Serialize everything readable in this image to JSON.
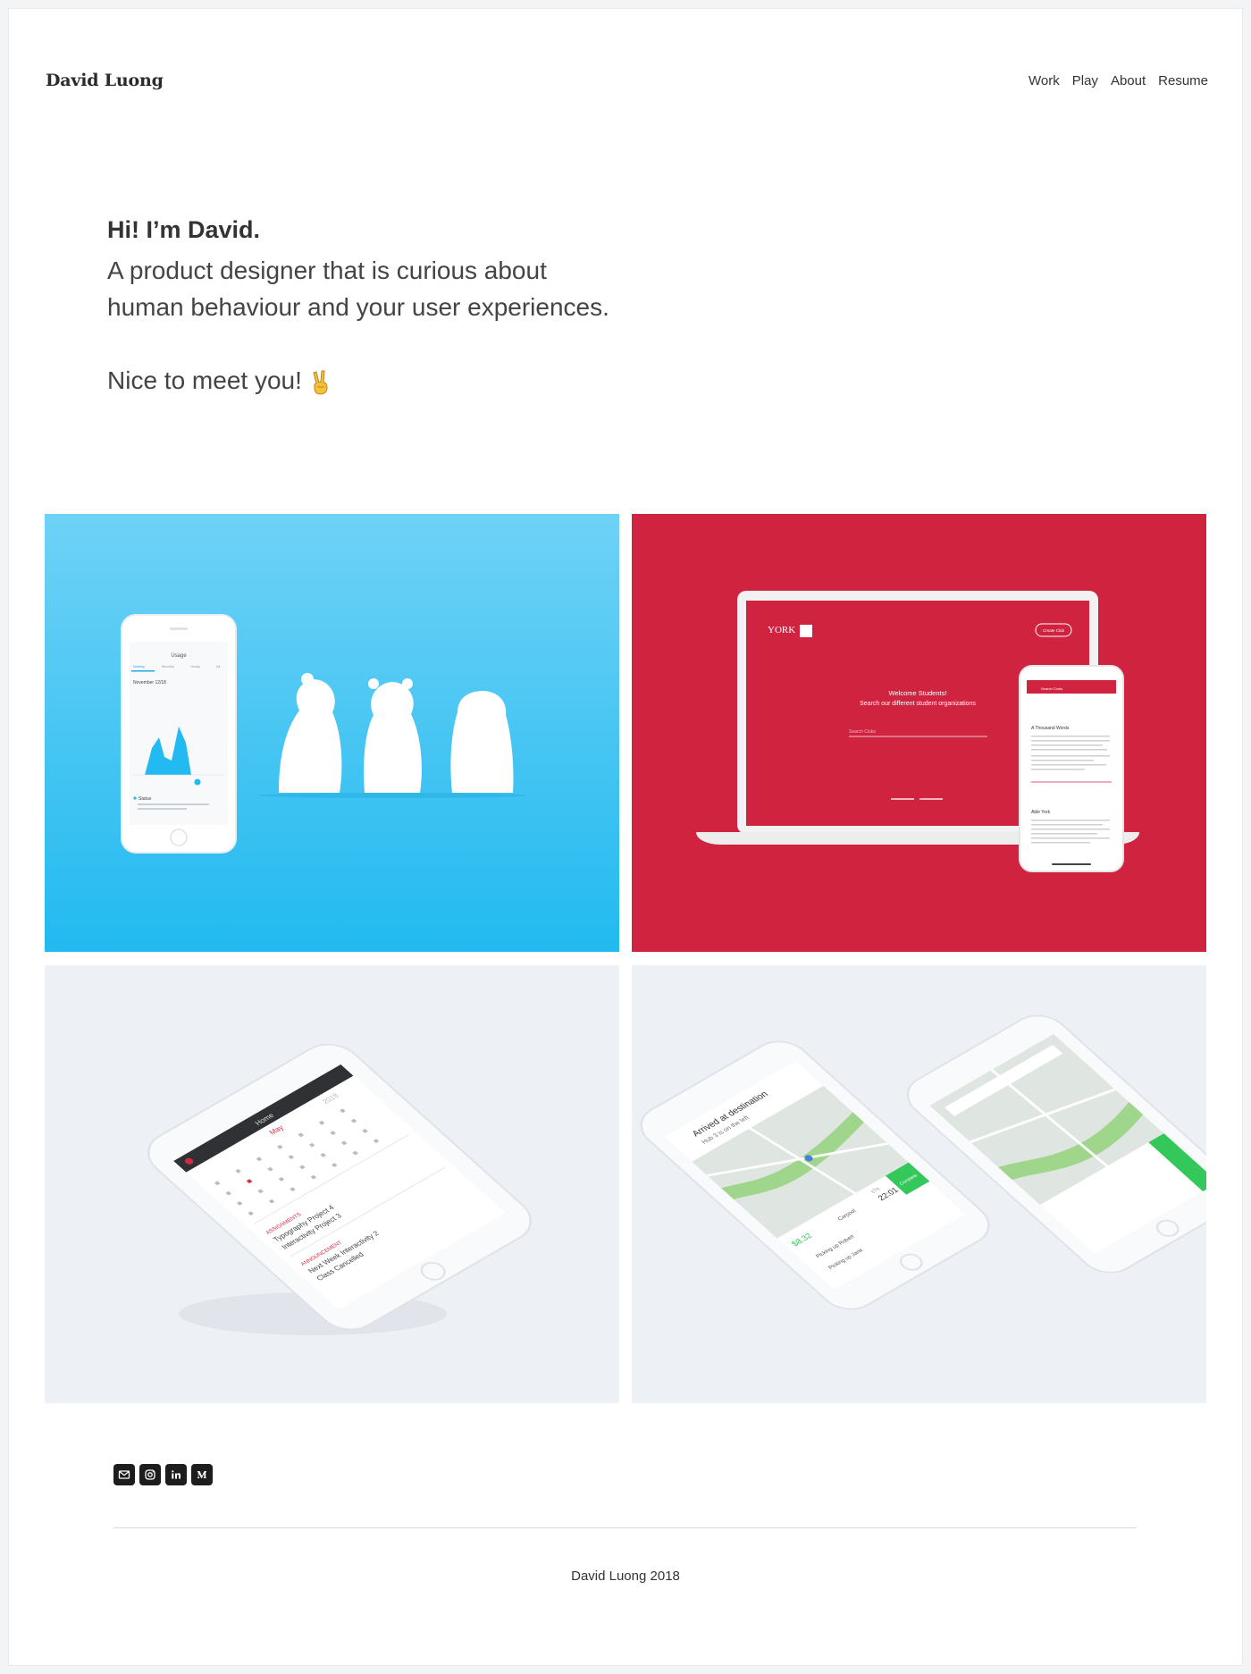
{
  "header": {
    "brand": "David Luong",
    "nav": [
      "Work",
      "Play",
      "About",
      "Resume"
    ]
  },
  "hero": {
    "greeting": "Hi! I’m David.",
    "tagline": "A product designer that is curious about human behaviour and your user experiences.",
    "meet": "Nice to meet you!",
    "meet_icon": "victory-hand-icon"
  },
  "projects": [
    {
      "icon": "usage-app-phone-mockup",
      "background": "#22baf0",
      "screen": {
        "title": "Usage",
        "tabs": [
          "Weekly",
          "Monthly",
          "Yearly",
          "All"
        ],
        "date": "November 12/18",
        "status_label": "Status"
      }
    },
    {
      "icon": "york-clubs-laptop-mockup",
      "background": "#cf2340",
      "screen": {
        "brand": "YORK",
        "button": "Create Club",
        "headline": "Welcome Students!",
        "subhead": "Search our different student organizations",
        "search_placeholder": "Search Clubs",
        "phone_search": "Search Clubs",
        "phone_card_1": "A Thousand Words",
        "phone_card_2": "Able York"
      }
    },
    {
      "icon": "calendar-app-phone-mockup",
      "background": "#edf0f4",
      "screen": {
        "title": "Home",
        "month": "May",
        "year": "2018",
        "section_1": "ASSIGNMENTS",
        "item_1": "Typography Project 4",
        "item_2": "Interactivity Project 3",
        "section_2": "ANNOUNCEMENT",
        "item_3": "Next Week Interactivity 2",
        "item_4": "Class Cancelled"
      }
    },
    {
      "icon": "rideshare-map-phones-mockup",
      "background": "#edf0f4",
      "screen": {
        "heading": "Arrived at destination",
        "subheading": "Hub 3 is on the left",
        "price": "$8.32",
        "time": "22:01",
        "eta_label": "ETA",
        "mode": "Carpool",
        "pickup_1": "Picking up Robert",
        "pickup_2": "Picking up Jane",
        "button": "Complete"
      }
    }
  ],
  "social": [
    "mail-icon",
    "instagram-icon",
    "linkedin-icon",
    "medium-icon"
  ],
  "footer": {
    "copyright": "David Luong 2018"
  },
  "colors": {
    "accent_blue": "#22baf0",
    "accent_red": "#cf2340",
    "text": "#333333"
  }
}
